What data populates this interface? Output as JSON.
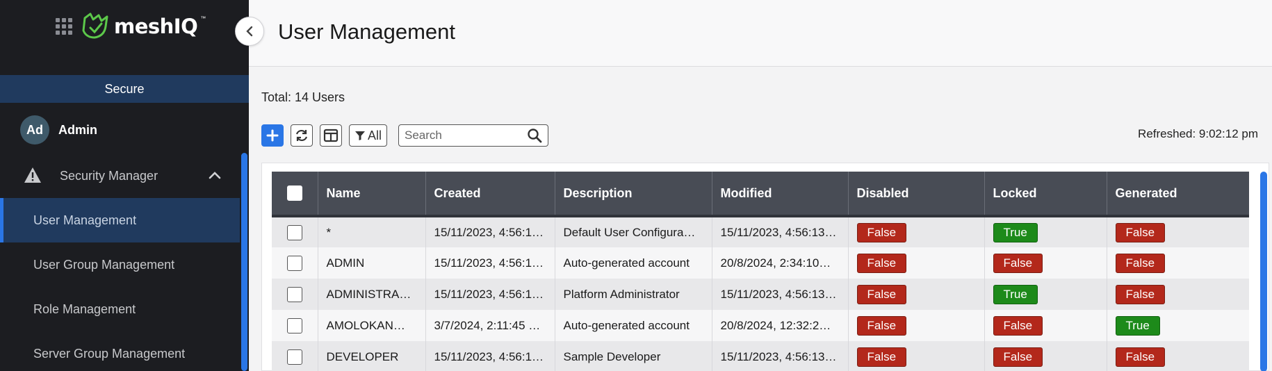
{
  "app": {
    "logo_text": "meshIQ",
    "logo_tm": "™"
  },
  "sidebar": {
    "section_bar": "Secure",
    "user": {
      "initials": "Ad",
      "name": "Admin"
    },
    "group_label": "Security Manager",
    "items": [
      {
        "label": "User Management",
        "active": true
      },
      {
        "label": "User Group Management",
        "active": false
      },
      {
        "label": "Role Management",
        "active": false
      },
      {
        "label": "Server Group Management",
        "active": false
      }
    ]
  },
  "header": {
    "title": "User Management"
  },
  "summary": {
    "total": "Total: 14 Users",
    "refreshed": "Refreshed: 9:02:12 pm"
  },
  "toolbar": {
    "filter_label": "All",
    "search_placeholder": "Search"
  },
  "table": {
    "columns": [
      "Name",
      "Created",
      "Description",
      "Modified",
      "Disabled",
      "Locked",
      "Generated"
    ],
    "rows": [
      {
        "name": "*",
        "created": "15/11/2023, 4:56:1…",
        "description": "Default User Configura…",
        "modified": "15/11/2023, 4:56:13 …",
        "disabled": "False",
        "locked": "True",
        "generated": "False"
      },
      {
        "name": "ADMIN",
        "created": "15/11/2023, 4:56:1…",
        "description": "Auto-generated account",
        "modified": "20/8/2024, 2:34:10…",
        "disabled": "False",
        "locked": "False",
        "generated": "False"
      },
      {
        "name": "ADMINISTRA…",
        "created": "15/11/2023, 4:56:1…",
        "description": "Platform Administrator",
        "modified": "15/11/2023, 4:56:13 …",
        "disabled": "False",
        "locked": "True",
        "generated": "False"
      },
      {
        "name": "AMOLOKAN…",
        "created": "3/7/2024, 2:11:45 …",
        "description": "Auto-generated account",
        "modified": "20/8/2024, 12:32:2…",
        "disabled": "False",
        "locked": "False",
        "generated": "True"
      },
      {
        "name": "DEVELOPER",
        "created": "15/11/2023, 4:56:1…",
        "description": "Sample Developer",
        "modified": "15/11/2023, 4:56:13 …",
        "disabled": "False",
        "locked": "False",
        "generated": "False"
      }
    ]
  },
  "colors": {
    "accent": "#2a76e6",
    "sidebar_bg": "#1c1d21",
    "active_bg": "#203a5e",
    "true_badge": "#1d8a1a",
    "false_badge": "#b3281b",
    "logo_green": "#5cc84a"
  },
  "icons": [
    "apps-grid-icon",
    "meshiq-logo-icon",
    "warning-icon",
    "chevron-up-icon",
    "chevron-left-icon",
    "plus-icon",
    "refresh-icon",
    "columns-icon",
    "filter-icon",
    "search-icon"
  ]
}
